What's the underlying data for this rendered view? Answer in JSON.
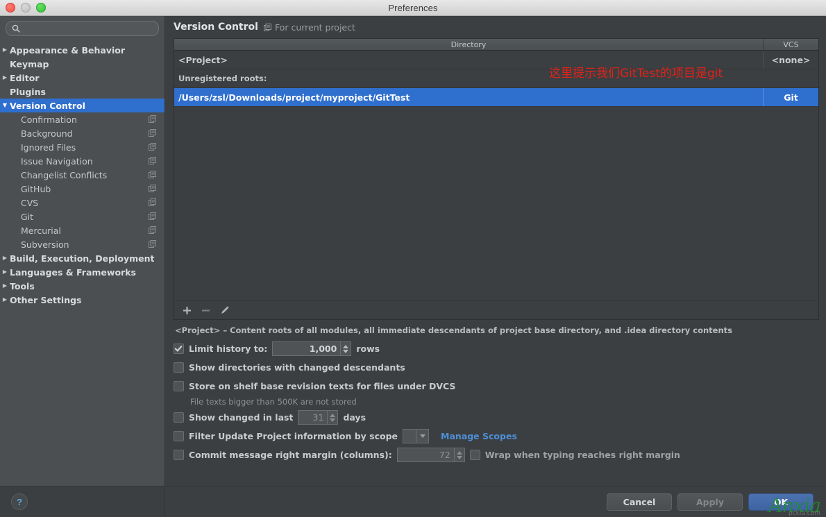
{
  "window": {
    "title": "Preferences",
    "traffic_lights": [
      "close-red",
      "minimize-gray",
      "zoom-green"
    ]
  },
  "sidebar": {
    "search": {
      "value": "",
      "placeholder": ""
    },
    "items": [
      {
        "label": "Appearance & Behavior",
        "level": 0,
        "arrow": "▶",
        "selected": false,
        "scope_icon": false
      },
      {
        "label": "Keymap",
        "level": 0,
        "arrow": "",
        "selected": false,
        "scope_icon": false
      },
      {
        "label": "Editor",
        "level": 0,
        "arrow": "▶",
        "selected": false,
        "scope_icon": false
      },
      {
        "label": "Plugins",
        "level": 0,
        "arrow": "",
        "selected": false,
        "scope_icon": false
      },
      {
        "label": "Version Control",
        "level": 0,
        "arrow": "▼",
        "selected": true,
        "scope_icon": false
      },
      {
        "label": "Confirmation",
        "level": 1,
        "arrow": "",
        "selected": false,
        "scope_icon": true
      },
      {
        "label": "Background",
        "level": 1,
        "arrow": "",
        "selected": false,
        "scope_icon": true
      },
      {
        "label": "Ignored Files",
        "level": 1,
        "arrow": "",
        "selected": false,
        "scope_icon": true
      },
      {
        "label": "Issue Navigation",
        "level": 1,
        "arrow": "",
        "selected": false,
        "scope_icon": true
      },
      {
        "label": "Changelist Conflicts",
        "level": 1,
        "arrow": "",
        "selected": false,
        "scope_icon": true
      },
      {
        "label": "GitHub",
        "level": 1,
        "arrow": "",
        "selected": false,
        "scope_icon": true
      },
      {
        "label": "CVS",
        "level": 1,
        "arrow": "",
        "selected": false,
        "scope_icon": true
      },
      {
        "label": "Git",
        "level": 1,
        "arrow": "",
        "selected": false,
        "scope_icon": true
      },
      {
        "label": "Mercurial",
        "level": 1,
        "arrow": "",
        "selected": false,
        "scope_icon": true
      },
      {
        "label": "Subversion",
        "level": 1,
        "arrow": "",
        "selected": false,
        "scope_icon": true
      },
      {
        "label": "Build, Execution, Deployment",
        "level": 0,
        "arrow": "▶",
        "selected": false,
        "scope_icon": false
      },
      {
        "label": "Languages & Frameworks",
        "level": 0,
        "arrow": "▶",
        "selected": false,
        "scope_icon": false
      },
      {
        "label": "Tools",
        "level": 0,
        "arrow": "▶",
        "selected": false,
        "scope_icon": false
      },
      {
        "label": "Other Settings",
        "level": 0,
        "arrow": "▶",
        "selected": false,
        "scope_icon": false
      }
    ],
    "help_label": "?"
  },
  "main": {
    "page_title": "Version Control",
    "scope_label": "For current project",
    "table": {
      "columns": [
        "Directory",
        "VCS"
      ],
      "rows": [
        {
          "kind": "entry",
          "directory": "<Project>",
          "vcs": "<none>",
          "selected": false
        },
        {
          "kind": "header",
          "directory": "Unregistered roots:",
          "vcs": "",
          "selected": false
        },
        {
          "kind": "entry",
          "directory": "/Users/zsl/Downloads/project/myproject/GitTest",
          "vcs": "Git",
          "selected": true
        }
      ],
      "annotation": "这里提示我们GitTest的项目是git",
      "annotation_color": "#e32119",
      "toolbar": [
        "add-icon",
        "remove-icon",
        "edit-icon"
      ]
    },
    "hint": "<Project> – Content roots of all modules, all immediate descendants of project base directory, and .idea directory contents",
    "options": [
      {
        "name": "limit-history",
        "label": "Limit history to:",
        "checked": true,
        "field_value": "1,000",
        "suffix": "rows"
      },
      {
        "name": "show-directories-changed-descendants",
        "label": "Show directories with changed descendants",
        "checked": false
      },
      {
        "name": "store-shelf-base-revision",
        "label": "Store on shelf base revision texts for files under DVCS",
        "checked": false,
        "sub_note": "File texts bigger than 500K are not stored"
      },
      {
        "name": "show-changed-in-last",
        "label": "Show changed in last",
        "checked": false,
        "field_value": "31",
        "suffix": "days"
      },
      {
        "name": "filter-update-project-by-scope",
        "label": "Filter Update Project information by scope",
        "checked": false,
        "combo_value": "",
        "link": "Manage Scopes"
      },
      {
        "name": "commit-message-right-margin",
        "label": "Commit message right margin (columns):",
        "checked": false,
        "field_value": "72",
        "extra_checkbox_label": "Wrap when typing reaches right margin",
        "extra_checked": false
      }
    ]
  },
  "footer": {
    "cancel": "Cancel",
    "apply": "Apply",
    "ok": "OK",
    "watermark": "Anxia",
    "watermark_sub": "pckia.com"
  }
}
